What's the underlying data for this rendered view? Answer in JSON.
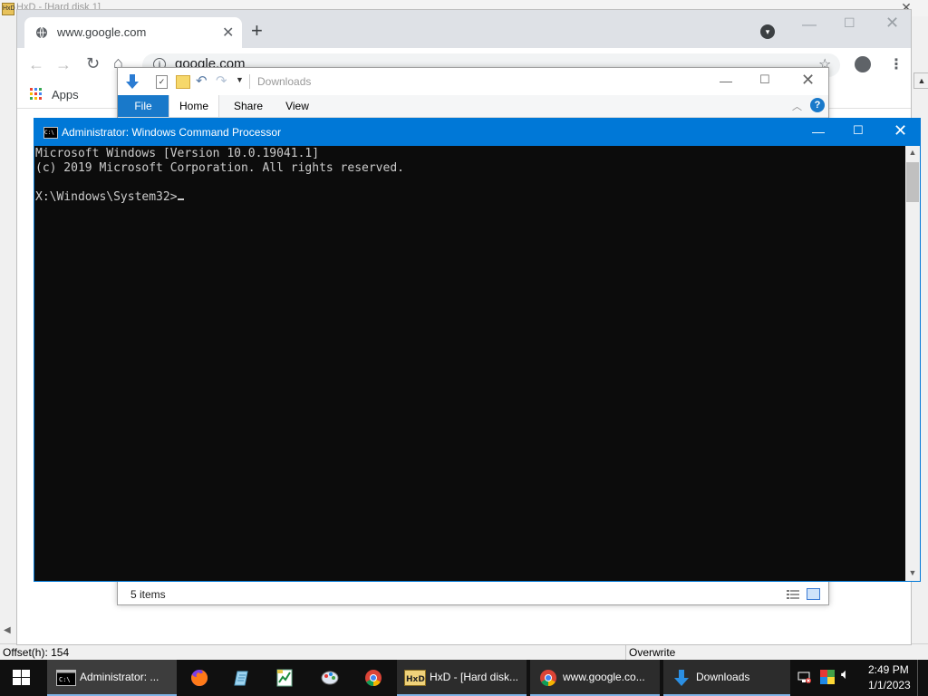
{
  "hxd": {
    "title": "HxD - [Hard disk 1]",
    "status_offset": "Offset(h): 154",
    "status_mode": "Overwrite"
  },
  "chrome": {
    "tab_title": "www.google.com",
    "url": "google.com",
    "bookmarks_apps": "Apps"
  },
  "explorer": {
    "title": "Downloads",
    "ribbon_tabs": [
      "File",
      "Home",
      "Share",
      "View"
    ],
    "status_items": "5 items"
  },
  "cmd": {
    "title": "Administrator: Windows Command Processor",
    "lines": [
      "Microsoft Windows [Version 10.0.19041.1]",
      "(c) 2019 Microsoft Corporation. All rights reserved.",
      "",
      "X:\\Windows\\System32>"
    ]
  },
  "taskbar": {
    "items": [
      {
        "label": "Administrator: ...",
        "icon": "cmd-icon"
      },
      {
        "label": "HxD - [Hard disk...",
        "icon": "hxd-icon"
      },
      {
        "label": "www.google.co...",
        "icon": "chrome-icon"
      },
      {
        "label": "Downloads",
        "icon": "download-arrow-icon"
      }
    ],
    "pinned": [
      "firefox-icon",
      "notepad-icon",
      "spreadsheet-icon",
      "paint-icon",
      "chrome-icon"
    ],
    "clock_time": "2:49 PM",
    "clock_date": "1/1/2023"
  },
  "colors": {
    "accent": "#0078d7",
    "taskbar": "#101010",
    "console_bg": "#0c0c0c",
    "console_text": "#cccccc",
    "file_tab": "#1979ca"
  }
}
